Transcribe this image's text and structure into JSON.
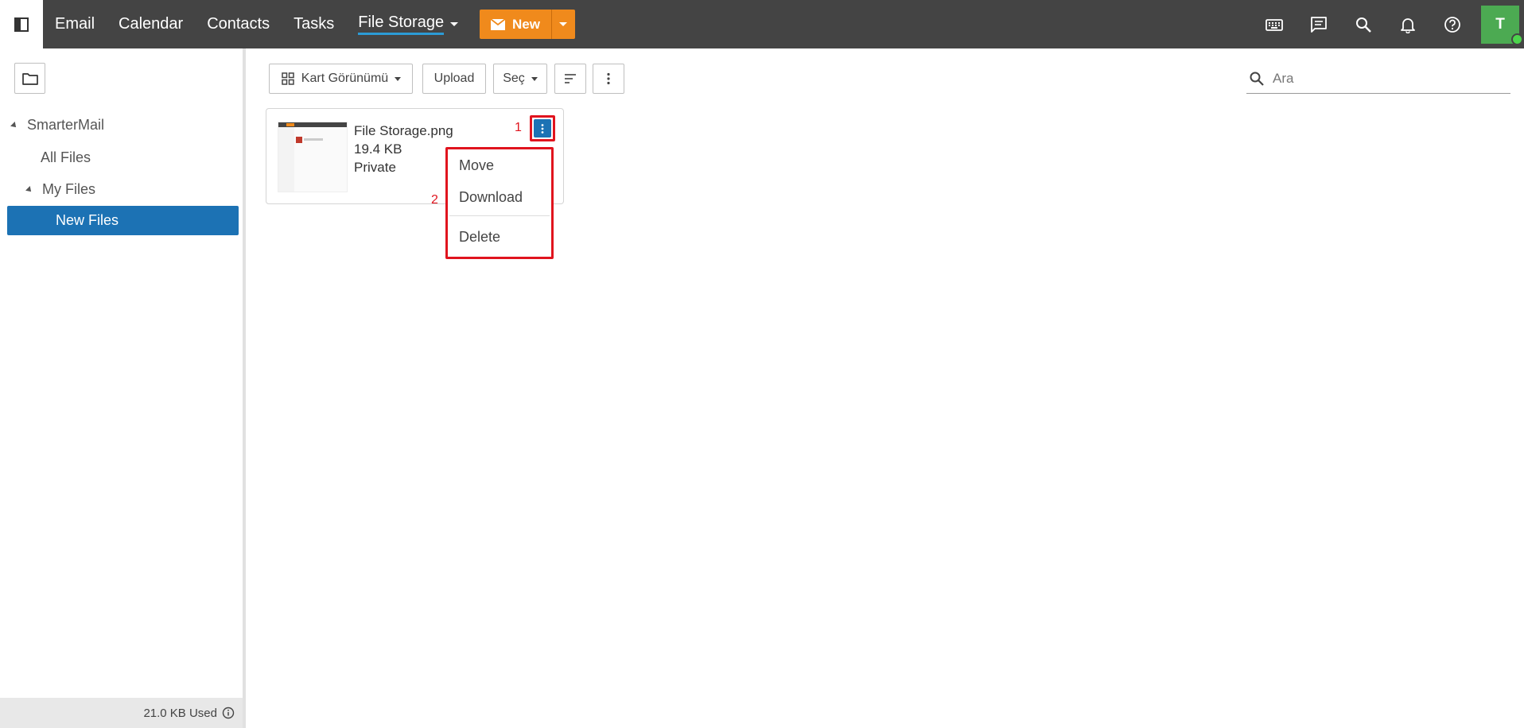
{
  "topbar": {
    "nav": [
      {
        "label": "Email"
      },
      {
        "label": "Calendar"
      },
      {
        "label": "Contacts"
      },
      {
        "label": "Tasks"
      },
      {
        "label": "File Storage",
        "active": true
      }
    ],
    "new_button": {
      "label": "New"
    },
    "avatar": {
      "initial": "T"
    },
    "icons": [
      "keyboard-icon",
      "chat-icon",
      "search-icon",
      "bell-icon",
      "help-icon"
    ],
    "colors": {
      "bar": "#444444",
      "accent": "#f08a1c",
      "active_underline": "#2c9bd6",
      "avatar": "#4caa52"
    }
  },
  "sidebar": {
    "tree": [
      {
        "label": "SmarterMail"
      },
      {
        "label": "All Files"
      },
      {
        "label": "My Files"
      },
      {
        "label": "New Files",
        "selected": true
      }
    ],
    "footer": {
      "usage": "21.0 KB Used"
    },
    "colors": {
      "selected": "#1c72b4"
    }
  },
  "toolbar": {
    "view_label": "Kart Görünümü",
    "upload_label": "Upload",
    "select_label": "Seç"
  },
  "search": {
    "placeholder": "Ara"
  },
  "file": {
    "name": "File Storage.png",
    "size": "19.4 KB",
    "privacy": "Private"
  },
  "annotations": {
    "one": "1",
    "two": "2",
    "color": "#e0141e"
  },
  "context_menu": {
    "items": [
      {
        "label": "Move"
      },
      {
        "label": "Download"
      },
      {
        "label": "Delete"
      }
    ]
  }
}
